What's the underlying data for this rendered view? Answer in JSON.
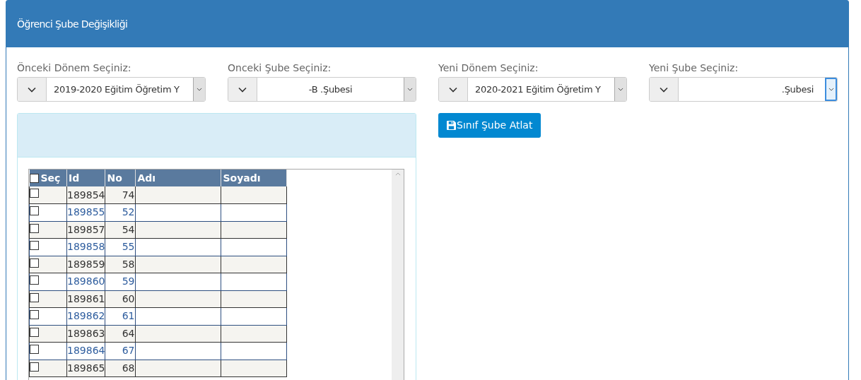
{
  "panel": {
    "title": "Öğrenci Şube Değişikliği"
  },
  "selects": [
    {
      "label": "Önceki Dönem Seçiniz:",
      "value": "2019-2020 Eğitim Öğretim Y",
      "focused": false
    },
    {
      "label": "Onceki Şube Seçiniz:",
      "value": "-B .Şubesi",
      "focused": false
    },
    {
      "label": "Yeni Dönem Seçiniz:",
      "value": "2020-2021 Eğitim Öğretim Y",
      "focused": false
    },
    {
      "label": "Yeni Şube Seçiniz:",
      "value": ".Şubesi",
      "focused": true
    }
  ],
  "save_button": {
    "label": "Sınıf Şube Atlat"
  },
  "table": {
    "select_all": {
      "checked": false
    },
    "columns": [
      "Seç",
      "Id",
      "No",
      "Adı",
      "Soyadı"
    ],
    "rows": [
      {
        "checked": false,
        "id": "189854",
        "no": "74"
      },
      {
        "checked": false,
        "id": "189855",
        "no": "52"
      },
      {
        "checked": false,
        "id": "189857",
        "no": "54"
      },
      {
        "checked": false,
        "id": "189858",
        "no": "55"
      },
      {
        "checked": false,
        "id": "189859",
        "no": "58"
      },
      {
        "checked": false,
        "id": "189860",
        "no": "59"
      },
      {
        "checked": false,
        "id": "189861",
        "no": "60"
      },
      {
        "checked": false,
        "id": "189862",
        "no": "61"
      },
      {
        "checked": false,
        "id": "189863",
        "no": "64"
      },
      {
        "checked": false,
        "id": "189864",
        "no": "67"
      },
      {
        "checked": false,
        "id": "189865",
        "no": "68"
      }
    ]
  }
}
